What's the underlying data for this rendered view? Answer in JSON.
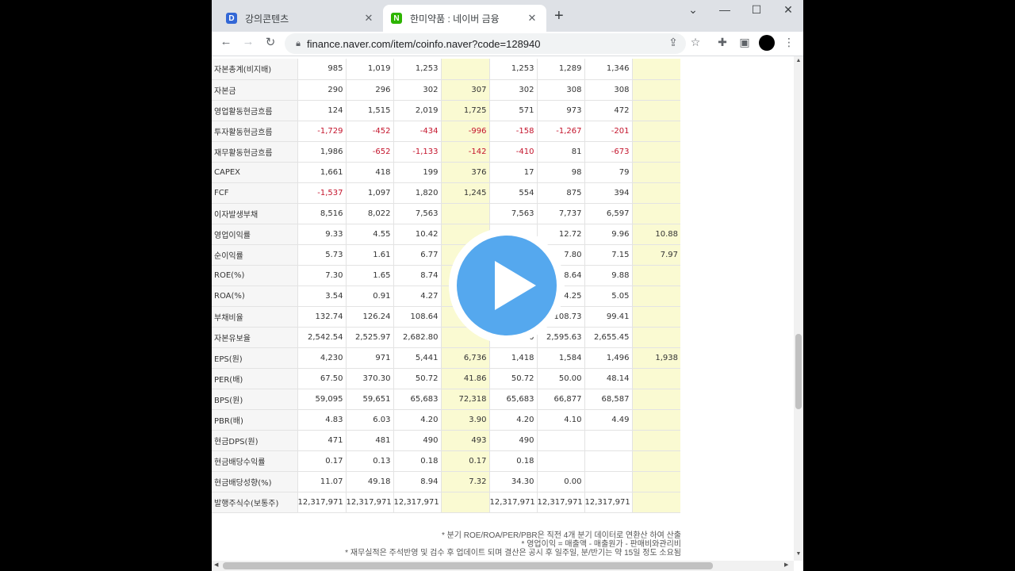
{
  "browser": {
    "tabs": [
      {
        "label": "강의콘텐츠",
        "favicon": "D"
      },
      {
        "label": "한미약품 : 네이버 금융",
        "favicon": "N"
      }
    ],
    "url": "finance.naver.com/item/coinfo.naver?code=128940"
  },
  "table": {
    "highlight_columns": [
      3,
      7
    ],
    "rows": [
      {
        "label": "자본총계(비지배)",
        "values": [
          "985",
          "1,019",
          "1,253",
          "",
          "1,253",
          "1,289",
          "1,346",
          ""
        ]
      },
      {
        "label": "자본금",
        "values": [
          "290",
          "296",
          "302",
          "307",
          "302",
          "308",
          "308",
          ""
        ]
      },
      {
        "label": "영업활동현금흐름",
        "values": [
          "124",
          "1,515",
          "2,019",
          "1,725",
          "571",
          "973",
          "472",
          ""
        ]
      },
      {
        "label": "투자활동현금흐름",
        "values": [
          "-1,729",
          "-452",
          "-434",
          "-996",
          "-158",
          "-1,267",
          "-201",
          ""
        ]
      },
      {
        "label": "재무활동현금흐름",
        "values": [
          "1,986",
          "-652",
          "-1,133",
          "-142",
          "-410",
          "81",
          "-673",
          ""
        ]
      },
      {
        "label": "CAPEX",
        "values": [
          "1,661",
          "418",
          "199",
          "376",
          "17",
          "98",
          "79",
          ""
        ]
      },
      {
        "label": "FCF",
        "values": [
          "-1,537",
          "1,097",
          "1,820",
          "1,245",
          "554",
          "875",
          "394",
          ""
        ]
      },
      {
        "label": "이자발생부채",
        "values": [
          "8,516",
          "8,022",
          "7,563",
          "",
          "7,563",
          "7,737",
          "6,597",
          ""
        ]
      },
      {
        "label": "영업이익률",
        "values": [
          "9.33",
          "4.55",
          "10.42",
          "",
          "",
          "12.72",
          "9.96",
          "10.88"
        ]
      },
      {
        "label": "순이익률",
        "values": [
          "5.73",
          "1.61",
          "6.77",
          "",
          "",
          "7.80",
          "7.15",
          "7.97"
        ]
      },
      {
        "label": "ROE(%)",
        "values": [
          "7.30",
          "1.65",
          "8.74",
          "",
          "",
          "8.64",
          "9.88",
          ""
        ]
      },
      {
        "label": "ROA(%)",
        "values": [
          "3.54",
          "0.91",
          "4.27",
          "",
          "",
          "4.25",
          "5.05",
          ""
        ]
      },
      {
        "label": "부채비율",
        "values": [
          "132.74",
          "126.24",
          "108.64",
          "",
          "",
          "108.73",
          "99.41",
          ""
        ]
      },
      {
        "label": "자본유보율",
        "values": [
          "2,542.54",
          "2,525.97",
          "2,682.80",
          "",
          "2,682.80",
          "2,595.63",
          "2,655.45",
          ""
        ]
      },
      {
        "label": "EPS(원)",
        "values": [
          "4,230",
          "971",
          "5,441",
          "6,736",
          "1,418",
          "1,584",
          "1,496",
          "1,938"
        ]
      },
      {
        "label": "PER(배)",
        "values": [
          "67.50",
          "370.30",
          "50.72",
          "41.86",
          "50.72",
          "50.00",
          "48.14",
          ""
        ]
      },
      {
        "label": "BPS(원)",
        "values": [
          "59,095",
          "59,651",
          "65,683",
          "72,318",
          "65,683",
          "66,877",
          "68,587",
          ""
        ]
      },
      {
        "label": "PBR(배)",
        "values": [
          "4.83",
          "6.03",
          "4.20",
          "3.90",
          "4.20",
          "4.10",
          "4.49",
          ""
        ]
      },
      {
        "label": "현금DPS(원)",
        "values": [
          "471",
          "481",
          "490",
          "493",
          "490",
          "",
          "",
          ""
        ]
      },
      {
        "label": "현금배당수익률",
        "values": [
          "0.17",
          "0.13",
          "0.18",
          "0.17",
          "0.18",
          "",
          "",
          ""
        ]
      },
      {
        "label": "현금배당성향(%)",
        "values": [
          "11.07",
          "49.18",
          "8.94",
          "7.32",
          "34.30",
          "0.00",
          "",
          ""
        ]
      },
      {
        "label": "발행주식수(보통주)",
        "values": [
          "12,317,971",
          "12,317,971",
          "12,317,971",
          "",
          "12,317,971",
          "12,317,971",
          "12,317,971",
          ""
        ]
      }
    ]
  },
  "notes": [
    "* 분기 ROE/ROA/PER/PBR은 직전 4개 분기 데이터로 연환산 하여 산출",
    "* 영업이익 = 매출액 - 매출원가 - 판매비와관리비",
    "* 재무실적은 주석반영 및 검수 후 업데이트 되며 결산은 공시 후 일주일, 분/반기는 약 15일 정도 소요됨"
  ],
  "colors": {
    "highlight": "#fafad2",
    "negative": "#c4142c",
    "play": "#55a8ee"
  }
}
